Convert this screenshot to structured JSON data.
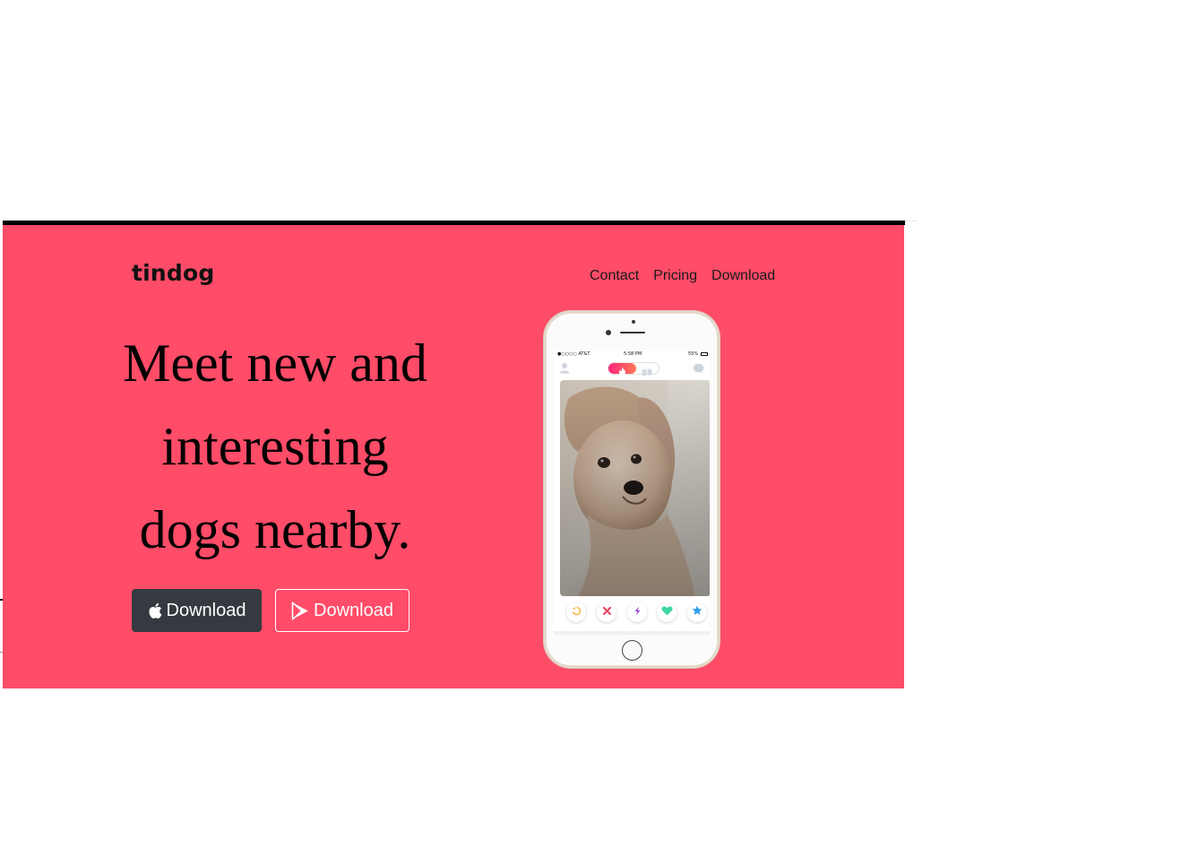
{
  "brand": {
    "name": "tindog"
  },
  "nav": {
    "items": [
      {
        "label": "Contact"
      },
      {
        "label": "Pricing"
      },
      {
        "label": "Download"
      }
    ]
  },
  "hero": {
    "headline_lines": [
      "Meet new and",
      "interesting",
      "dogs nearby."
    ],
    "buttons": {
      "apple": {
        "label": "Download",
        "icon": "apple-icon"
      },
      "play": {
        "label": "Download",
        "icon": "google-play-icon"
      }
    }
  },
  "phone": {
    "status_bar": {
      "carrier": "●○○○○ AT&T",
      "time": "5:58 PM",
      "battery": "55%"
    },
    "actions": [
      {
        "icon": "rewind-icon",
        "color": "#f5b748"
      },
      {
        "icon": "nope-icon",
        "color": "#e8475f"
      },
      {
        "icon": "boost-icon",
        "color": "#9b4fd8"
      },
      {
        "icon": "like-icon",
        "color": "#3fd6a5"
      },
      {
        "icon": "super-like-icon",
        "color": "#2e9dea"
      }
    ]
  },
  "colors": {
    "hero_bg": "#ff4c68",
    "dark_button": "#343a40",
    "text": "#000000"
  }
}
